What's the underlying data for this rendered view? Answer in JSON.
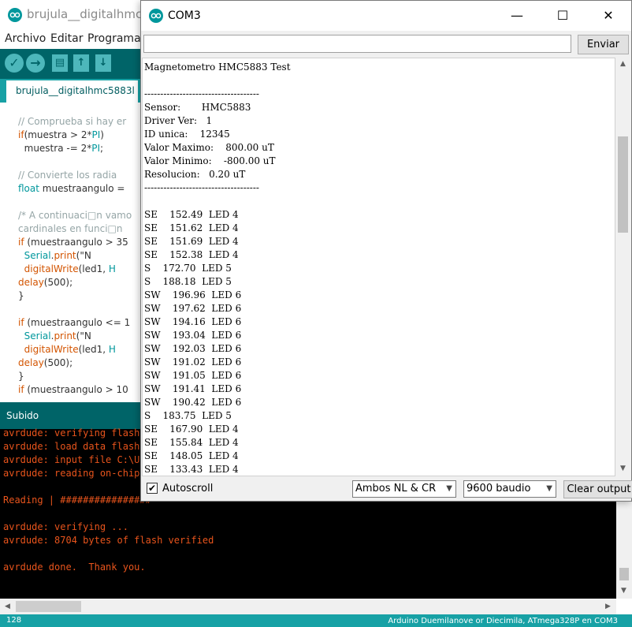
{
  "ide": {
    "title": "brujula__digitalhmc58",
    "menu": [
      "Archivo",
      "Editar",
      "Programa"
    ],
    "tab_label": "brujula__digitalhmc5883l",
    "code_lines": [
      {
        "text": "// Comprueba si hay er",
        "cls": "cm"
      },
      {
        "text": "if(muestra > 2*PI)",
        "cls": ""
      },
      {
        "text": "  muestra -= 2*PI;",
        "cls": ""
      },
      {
        "text": "",
        "cls": ""
      },
      {
        "text": "// Convierte los radia",
        "cls": "cm"
      },
      {
        "text": "float muestraangulo =",
        "cls": ""
      },
      {
        "text": "",
        "cls": ""
      },
      {
        "text": "/* A continuaci□n vamo",
        "cls": "cm"
      },
      {
        "text": "cardinales en funci□n",
        "cls": "cm"
      },
      {
        "text": "if (muestraangulo > 35",
        "cls": ""
      },
      {
        "text": "  Serial.print(\"N",
        "cls": ""
      },
      {
        "text": "  digitalWrite(led1, H",
        "cls": ""
      },
      {
        "text": "delay(500);",
        "cls": ""
      },
      {
        "text": "}",
        "cls": ""
      },
      {
        "text": "",
        "cls": ""
      },
      {
        "text": "if (muestraangulo <= 1",
        "cls": ""
      },
      {
        "text": "  Serial.print(\"N",
        "cls": ""
      },
      {
        "text": "  digitalWrite(led1, H",
        "cls": ""
      },
      {
        "text": "delay(500);",
        "cls": ""
      },
      {
        "text": "}",
        "cls": ""
      },
      {
        "text": "if (muestraangulo > 10",
        "cls": ""
      }
    ],
    "status_label": "Subido",
    "console_lines": [
      "avrdude: verifying flash",
      "avrdude: load data flash",
      "avrdude: input file C:\\Us",
      "avrdude: reading on-chip",
      "",
      "Reading | ################",
      "",
      "avrdude: verifying ...",
      "avrdude: 8704 bytes of flash verified",
      "",
      "avrdude done.  Thank you."
    ],
    "line_number": "128",
    "board": "Arduino Duemilanove or Diecimila, ATmega328P en COM3"
  },
  "serial_monitor": {
    "title": "COM3",
    "send_label": "Enviar",
    "input_value": "",
    "output_lines": [
      "Magnetometro HMC5883 Test",
      "",
      "------------------------------------",
      "Sensor:       HMC5883",
      "Driver Ver:   1",
      "ID unica:    12345",
      "Valor Maximo:    800.00 uT",
      "Valor Minimo:    -800.00 uT",
      "Resolucion:   0.20 uT",
      "------------------------------------",
      "",
      "SE    152.49  LED 4",
      "SE    151.62  LED 4",
      "SE    151.69  LED 4",
      "SE    152.38  LED 4",
      "S    172.70  LED 5",
      "S    188.18  LED 5",
      "SW    196.96  LED 6",
      "SW    197.62  LED 6",
      "SW    194.16  LED 6",
      "SW    193.04  LED 6",
      "SW    192.03  LED 6",
      "SW    191.02  LED 6",
      "SW    191.05  LED 6",
      "SW    191.41  LED 6",
      "SW    190.42  LED 6",
      "S    183.75  LED 5",
      "SE    167.90  LED 4",
      "SE    155.84  LED 4",
      "SE    148.05  LED 4",
      "SE    133.43  LED 4"
    ],
    "autoscroll_label": "Autoscroll",
    "autoscroll_checked": "✔",
    "line_ending": "Ambos NL & CR",
    "baud_rate": "9600 baudio",
    "clear_label": "Clear output"
  },
  "colors": {
    "ide_teal_dark": "#006468",
    "ide_teal": "#17a1a5",
    "console_text": "#e8541c"
  }
}
